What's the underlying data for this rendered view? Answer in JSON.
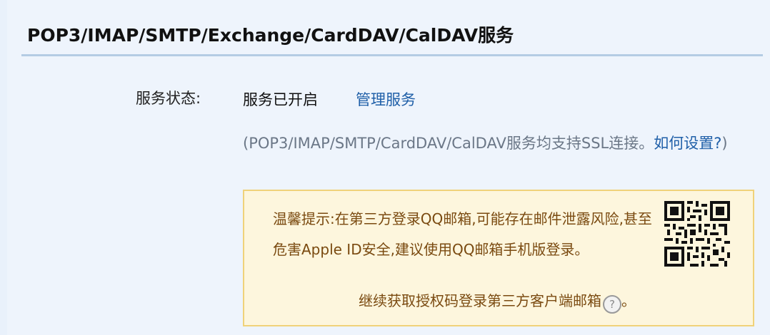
{
  "section": {
    "title": "POP3/IMAP/SMTP/Exchange/CardDAV/CalDAV服务"
  },
  "status": {
    "label": "服务状态:",
    "value": "服务已开启",
    "manage_link": "管理服务"
  },
  "ssl_note": {
    "text": "(POP3/IMAP/SMTP/CardDAV/CalDAV服务均支持SSL连接。",
    "help_link": "如何设置?",
    "close_paren": ")"
  },
  "tip": {
    "text": "温馨提示:在第三方登录QQ邮箱,可能存在邮件泄露风险,甚至危害Apple ID安全,建议使用QQ邮箱手机版登录。",
    "auth_link": "继续获取授权码登录第三方客户端邮箱",
    "help_icon_glyph": "?",
    "end_punct": "。"
  },
  "icons": {
    "qr": "qr-code-icon",
    "help": "help-circle-icon"
  },
  "colors": {
    "link": "#1f5fa8",
    "tip_bg": "#fdf6dd",
    "tip_border": "#f0d27a",
    "tip_text": "#7a4a10",
    "rule": "#b4cce4"
  }
}
